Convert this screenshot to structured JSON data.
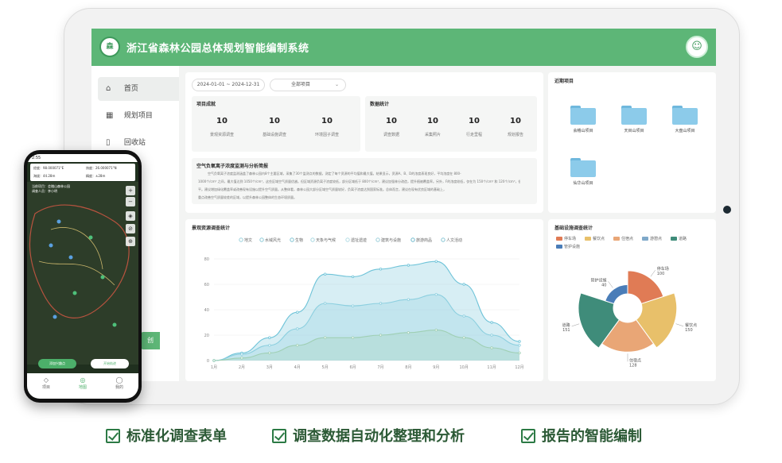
{
  "app": {
    "title": "浙江省森林公园总体规划智能编制系统",
    "logo_text": "森"
  },
  "sidebar": {
    "items": [
      {
        "label": "首页",
        "icon": "home-icon",
        "glyph": "⌂"
      },
      {
        "label": "规划项目",
        "icon": "grid-icon",
        "glyph": "▦"
      },
      {
        "label": "回收站",
        "icon": "trash-icon",
        "glyph": "▯"
      }
    ],
    "bottom_button": "创"
  },
  "filters": {
    "date_range": "2024-01-01 ~ 2024-12-31",
    "project_select": "全部项目"
  },
  "project_stats": {
    "title": "项目成就",
    "items": [
      {
        "value": "10",
        "label": "景观资源调查"
      },
      {
        "value": "10",
        "label": "基础设施调查"
      },
      {
        "value": "10",
        "label": "环境因子调查"
      }
    ]
  },
  "data_stats": {
    "title": "数据统计",
    "items": [
      {
        "value": "10",
        "label": "调查数据"
      },
      {
        "value": "10",
        "label": "采集照片"
      },
      {
        "value": "10",
        "label": "行走里程"
      },
      {
        "value": "10",
        "label": "规划报告"
      }
    ]
  },
  "report": {
    "title": "空气负氧离子浓度监测与分析简报",
    "lines": [
      "空气负氧离子浓度监测涵盖了森林公园内8个主要区域，采集了30个监测点的数据，测定了每个资源的平均值和最大值。结果显示，资源A、B、D的浓度表现良好，平均浓度在 800-",
      "1000个/cm³ 之间，最大值达到 1050个/cm³，这些区域空气质量优越。但区域资源负离子浓度较低，部分区域低于 800个/cm³，建议加强林分改造，提升植被覆盖率。另外，F的浓度较低，仅在为 150个/cm³ 和 120个/cm³，低于一般水",
      "平。建议增加绿化覆盖率或改善现有设施以提升空气质量。从整体看，森林公园大部分区域空气质量较好，负离子浓度达到国家标准。总体而言，建议在现有优良区域的基础上，",
      "重点改善空气质量较差的区域，以提升森林公园整体的生态环境质量。"
    ]
  },
  "recent_projects": {
    "title": "近期项目",
    "items": [
      {
        "label": "会稽山项目"
      },
      {
        "label": "天目山项目"
      },
      {
        "label": "大盘山项目"
      },
      {
        "label": "仙华山项目"
      }
    ]
  },
  "landscape_chart": {
    "title": "景观资源调查统计",
    "chart_data": {
      "type": "area",
      "title": "景观资源调查统计",
      "categories": [
        "1月",
        "2月",
        "3月",
        "4月",
        "5月",
        "6月",
        "7月",
        "8月",
        "9月",
        "10月",
        "11月",
        "12月"
      ],
      "ylim": [
        0,
        80
      ],
      "yticks": [
        0,
        20,
        40,
        60,
        80
      ],
      "legend": [
        "地文",
        "水域风光",
        "生物",
        "天象与气候",
        "遗址遗迹",
        "建筑与设施",
        "旅游商品",
        "人文活动"
      ],
      "legend_position": "top",
      "series": [
        {
          "name": "地文",
          "values": [
            0,
            2,
            6,
            12,
            18,
            18,
            20,
            22,
            24,
            18,
            10,
            6
          ]
        },
        {
          "name": "水域风光",
          "values": [
            0,
            5,
            12,
            25,
            45,
            43,
            45,
            48,
            52,
            35,
            20,
            12
          ]
        },
        {
          "name": "生物",
          "values": [
            0,
            6,
            18,
            38,
            68,
            66,
            72,
            75,
            78,
            60,
            30,
            15
          ]
        }
      ],
      "colors": [
        "#9fcfb4",
        "#8ccfdf",
        "#6ec3d8"
      ]
    }
  },
  "infra_chart": {
    "title": "基础设施调查统计",
    "chart_data": {
      "type": "pie",
      "title": "基础设施调查统计",
      "legend": [
        "停车场",
        "餐饮点",
        "住宿点",
        "游憩点",
        "道路",
        "管护设施"
      ],
      "legend_position": "top",
      "slices": [
        {
          "name": "停车场",
          "value": 100,
          "color": "#e07b55"
        },
        {
          "name": "餐饮点",
          "value": 150,
          "color": "#e8c06a"
        },
        {
          "name": "住宿点",
          "value": 128,
          "color": "#e9a676"
        },
        {
          "name": "道路",
          "value": 151,
          "color": "#3f8c7a"
        },
        {
          "name": "管护设施",
          "value": 40,
          "color": "#4a7db8"
        }
      ],
      "labels": [
        {
          "name": "停车场",
          "value": "100"
        },
        {
          "name": "餐饮点",
          "value": "150"
        },
        {
          "name": "住宿点",
          "value": "128"
        },
        {
          "name": "道路",
          "value": "151"
        },
        {
          "name": "管护设施",
          "value": "40"
        }
      ]
    }
  },
  "phone": {
    "status_time": "2:55",
    "coords": [
      {
        "text": "经度：98.000071°E"
      },
      {
        "text": "纬度：26.000071°N"
      },
      {
        "text": "海拔：44.28m"
      },
      {
        "text": "精度：±28m"
      }
    ],
    "map_info": [
      "当前项目：会稽山森林公园",
      "调查人员：李小明"
    ],
    "buttons": [
      {
        "label": "添加兴趣点"
      },
      {
        "label": "开始轨迹"
      }
    ],
    "nav": [
      {
        "label": "项目",
        "glyph": "◇"
      },
      {
        "label": "地图",
        "glyph": "◎"
      },
      {
        "label": "我的",
        "glyph": "◯"
      }
    ]
  },
  "features": [
    {
      "label": "标准化调查表单"
    },
    {
      "label": "调查数据自动化整理和分析"
    },
    {
      "label": "报告的智能编制"
    }
  ]
}
